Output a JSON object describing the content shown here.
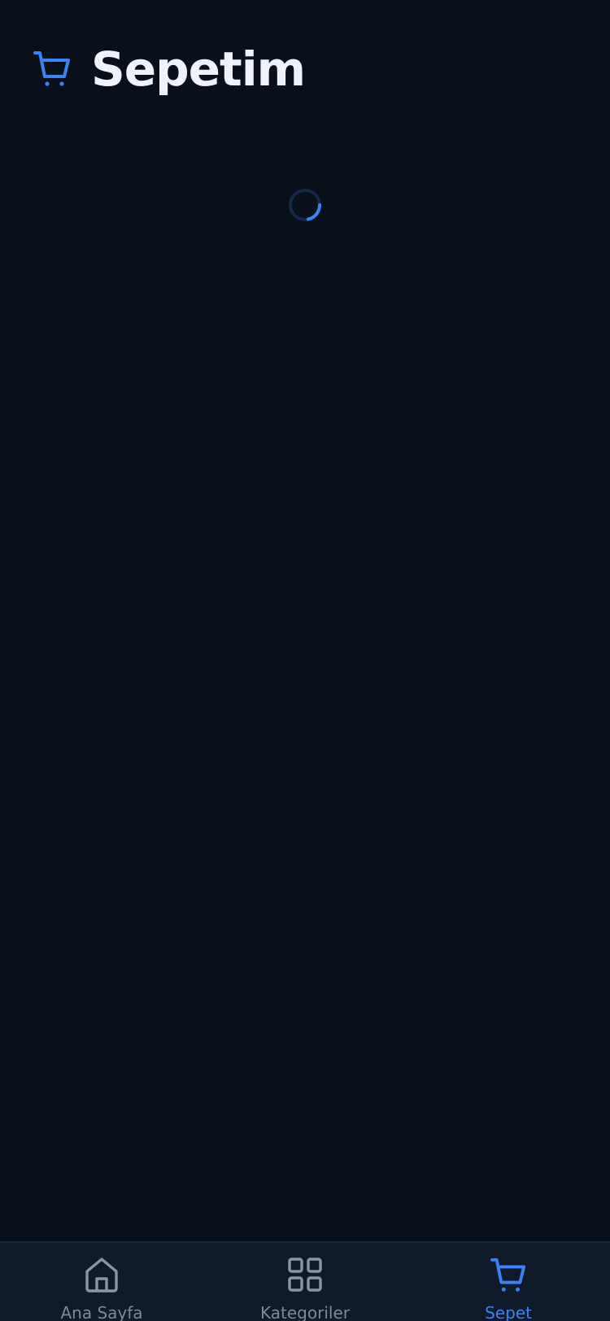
{
  "header": {
    "title": "Sepetim",
    "icon": "cart-icon"
  },
  "main": {
    "loading": true
  },
  "tabbar": {
    "items": [
      {
        "label": "Ana Sayfa",
        "icon": "home-icon",
        "active": false
      },
      {
        "label": "Kategoriler",
        "icon": "grid-icon",
        "active": false
      },
      {
        "label": "Sepet",
        "icon": "cart-icon",
        "active": true
      }
    ]
  },
  "colors": {
    "background": "#09101b",
    "tabbar_background": "#0f1a2a",
    "accent": "#3b82f6",
    "title_text": "#eef2fa",
    "inactive": "#7c8a9d",
    "inactive_icon": "#8a96a6"
  }
}
